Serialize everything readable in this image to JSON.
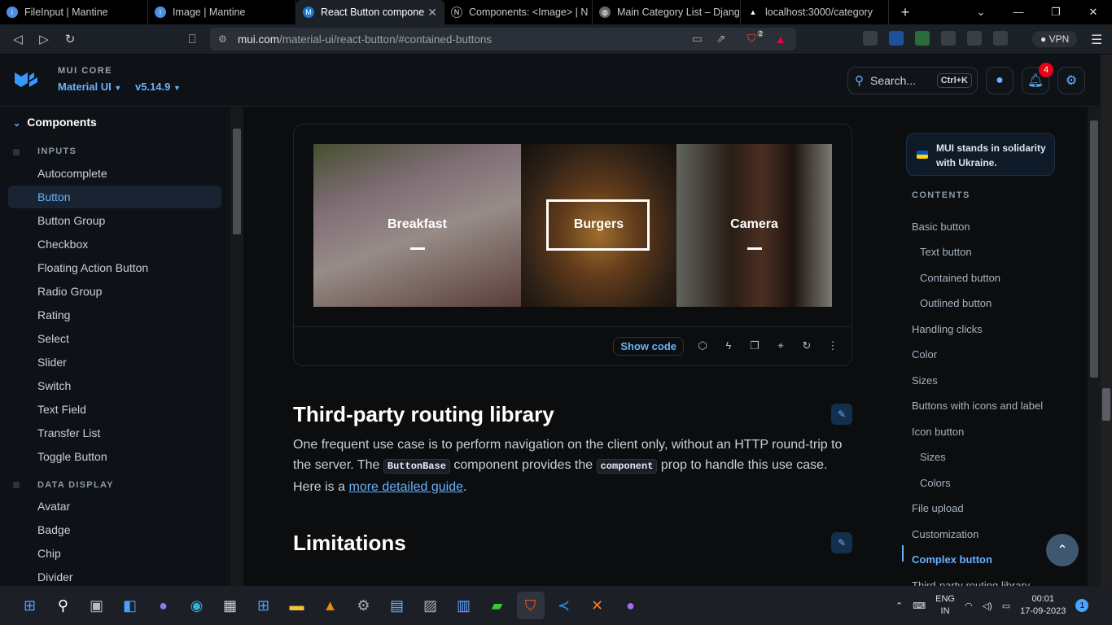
{
  "browser": {
    "tabs": [
      {
        "title": "FileInput | Mantine",
        "icon": "mantine-icon",
        "active": false
      },
      {
        "title": "Image | Mantine",
        "icon": "mantine-icon",
        "active": false
      },
      {
        "title": "React Button compone",
        "icon": "mui-icon",
        "active": true
      },
      {
        "title": "Components: <Image> | N",
        "icon": "nextjs-icon",
        "active": false
      },
      {
        "title": "Main Category List – Djang",
        "icon": "globe-icon",
        "active": false
      },
      {
        "title": "localhost:3000/category",
        "icon": "triangle-icon",
        "active": false
      }
    ],
    "url_host": "mui.com",
    "url_path": "/material-ui/react-button/#contained-buttons",
    "shield_count": "2",
    "vpn_label": "VPN"
  },
  "header": {
    "brand_top": "MUI CORE",
    "product": "Material UI",
    "version": "v5.14.9",
    "search_label": "Search...",
    "search_shortcut": "Ctrl+K",
    "notification_count": "4"
  },
  "sidebar": {
    "category": "Components",
    "sections": [
      {
        "title": "INPUTS",
        "items": [
          "Autocomplete",
          "Button",
          "Button Group",
          "Checkbox",
          "Floating Action Button",
          "Radio Group",
          "Rating",
          "Select",
          "Slider",
          "Switch",
          "Text Field",
          "Transfer List",
          "Toggle Button"
        ]
      },
      {
        "title": "DATA DISPLAY",
        "items": [
          "Avatar",
          "Badge",
          "Chip",
          "Divider"
        ]
      }
    ],
    "selected": "Button"
  },
  "demo": {
    "images": [
      {
        "label": "Breakfast"
      },
      {
        "label": "Burgers"
      },
      {
        "label": "Camera"
      }
    ],
    "show_code": "Show code"
  },
  "content": {
    "h_routing": "Third-party routing library",
    "para_1": "One frequent use case is to perform navigation on the client only, without an HTTP round-trip to the server. The",
    "code_1": "ButtonBase",
    "para_2": "component provides the",
    "code_2": "component",
    "para_3": "prop to handle this use case. Here is a",
    "link": "more detailed guide",
    "para_4": ".",
    "h_limitations": "Limitations"
  },
  "toc": {
    "banner": "MUI stands in solidarity with Ukraine.",
    "heading": "CONTENTS",
    "items": [
      {
        "label": "Basic button",
        "sub": false
      },
      {
        "label": "Text button",
        "sub": true
      },
      {
        "label": "Contained button",
        "sub": true
      },
      {
        "label": "Outlined button",
        "sub": true
      },
      {
        "label": "Handling clicks",
        "sub": false
      },
      {
        "label": "Color",
        "sub": false
      },
      {
        "label": "Sizes",
        "sub": false
      },
      {
        "label": "Buttons with icons and label",
        "sub": false
      },
      {
        "label": "Icon button",
        "sub": false
      },
      {
        "label": "Sizes",
        "sub": true
      },
      {
        "label": "Colors",
        "sub": true
      },
      {
        "label": "File upload",
        "sub": false
      },
      {
        "label": "Customization",
        "sub": false
      },
      {
        "label": "Complex button",
        "sub": false,
        "active": true
      },
      {
        "label": "Third-party routing library",
        "sub": false
      }
    ]
  },
  "taskbar": {
    "lang_1": "ENG",
    "lang_2": "IN",
    "time": "00:01",
    "date": "17-09-2023",
    "notifications": "1"
  },
  "colors": {
    "accent": "#66b2ff",
    "badge": "#eb0014",
    "bg": "#0b0d0e"
  }
}
